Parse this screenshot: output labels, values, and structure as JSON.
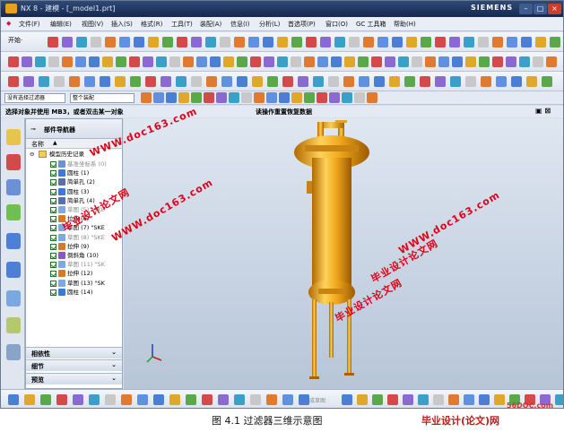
{
  "window": {
    "title": "NX 8 - 建模 - [_model1.prt]",
    "brand": "SIEMENS"
  },
  "menus": [
    "文件(F)",
    "编辑(E)",
    "视图(V)",
    "插入(S)",
    "格式(R)",
    "工具(T)",
    "装配(A)",
    "信息(I)",
    "分析(L)",
    "首选项(P)",
    "窗口(O)",
    "GC 工具箱",
    "帮助(H)"
  ],
  "toolbar": {
    "start_label": "开始·"
  },
  "filter": {
    "type_filter": "没有选择过滤器",
    "scope": "整个装配"
  },
  "cue": {
    "left": "选择对象并使用 MB3，或者双击某一对象",
    "center": "读操作重置恢复数据"
  },
  "navigator": {
    "title": "部件导航器",
    "column": "名称",
    "root": "模型历史记录",
    "items": [
      {
        "label": "基准坐标系 (0)",
        "dim": true
      },
      {
        "label": "圆柱 (1)",
        "dim": false
      },
      {
        "label": "简单孔 (2)",
        "dim": false
      },
      {
        "label": "圆柱 (3)",
        "dim": false
      },
      {
        "label": "简单孔 (4)",
        "dim": false
      },
      {
        "label": "草图 (5) \"SKE",
        "dim": true
      },
      {
        "label": "拉伸 (6)",
        "dim": false
      },
      {
        "label": "草图 (7) \"SKE",
        "dim": false
      },
      {
        "label": "草图 (8) \"SKE",
        "dim": true
      },
      {
        "label": "拉伸 (9)",
        "dim": false
      },
      {
        "label": "倒斜角 (10)",
        "dim": false
      },
      {
        "label": "草图 (11) \"SK",
        "dim": true
      },
      {
        "label": "拉伸 (12)",
        "dim": false
      },
      {
        "label": "草图 (13) \"SK",
        "dim": false
      },
      {
        "label": "圆柱 (14)",
        "dim": false
      }
    ],
    "sections": [
      "相依性",
      "细节",
      "预览"
    ]
  },
  "bottom": {
    "sketch_finish": "完成草图"
  },
  "watermarks": [
    "WWW.doc163.com",
    "毕业设计论文网",
    "WWW.doc163.com",
    "毕业设计论文网",
    "WWW.doc163.com",
    "毕业设计论文网"
  ],
  "caption": "图 4.1 过滤器三维示意图",
  "footer_logo": "毕业设计(论文)网",
  "site_url": "56DOC.com",
  "colors": {
    "model": "#f2a81c",
    "title_bar": "#1d3563",
    "viewport_top": "#dfe7f1",
    "watermark": "#e0001a"
  }
}
